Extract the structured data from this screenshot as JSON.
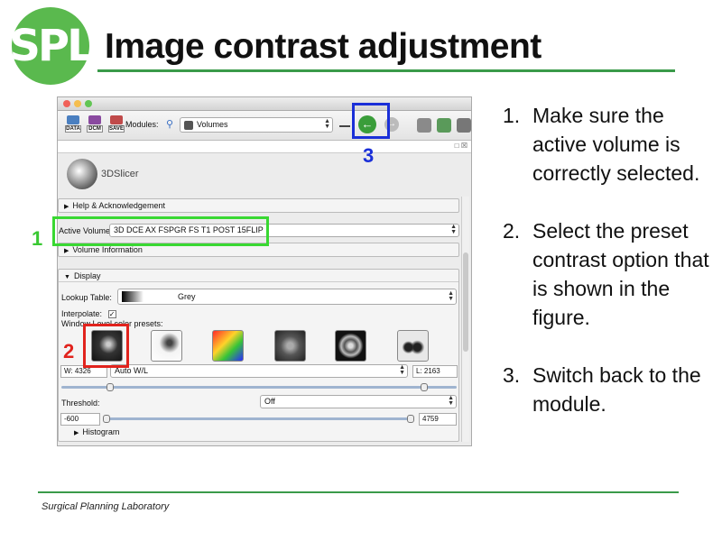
{
  "header": {
    "logo_text": "SPL",
    "title": "Image contrast adjustment"
  },
  "footer": {
    "text": "Surgical Planning Laboratory"
  },
  "slicer": {
    "toolbar": {
      "data_label": "DATA",
      "dcm_label": "DCM",
      "save_label": "SAVE",
      "modules_label": "Modules:",
      "module_selected": "Volumes",
      "back_icon": "back-arrow-icon",
      "forward_icon": "forward-arrow-icon"
    },
    "logo_text": "3DSlicer",
    "sections": {
      "help": "Help & Acknowledgement",
      "volume_info": "Volume Information",
      "display": "Display",
      "histogram": "Histogram"
    },
    "active_volume": {
      "label": "Active Volume",
      "value": "3D DCE AX FSPGR FS T1 POST 15FLIP"
    },
    "lookup_table": {
      "label": "Lookup Table:",
      "value": "Grey"
    },
    "interpolate": {
      "label": "Interpolate:",
      "checked": "✓"
    },
    "presets_label": "Window Level color presets:",
    "window_level": {
      "w": "W: 4326",
      "mode": "Auto W/L",
      "l": "L: 2163"
    },
    "threshold": {
      "label": "Threshold:",
      "value": "Off",
      "min": "-600",
      "max": "4759"
    }
  },
  "annotations": {
    "n1": "1",
    "n2": "2",
    "n3": "3"
  },
  "steps": [
    {
      "num": "1.",
      "text": "Make sure the active volume is correctly selected."
    },
    {
      "num": "2.",
      "text": "Select the preset contrast option that is shown in the figure."
    },
    {
      "num": "3.",
      "text": "Switch back to the module."
    }
  ],
  "colors": {
    "accent_green": "#3a9a4a",
    "highlight_green": "#39d832",
    "highlight_red": "#e1231d",
    "highlight_blue": "#1a2fd8"
  }
}
